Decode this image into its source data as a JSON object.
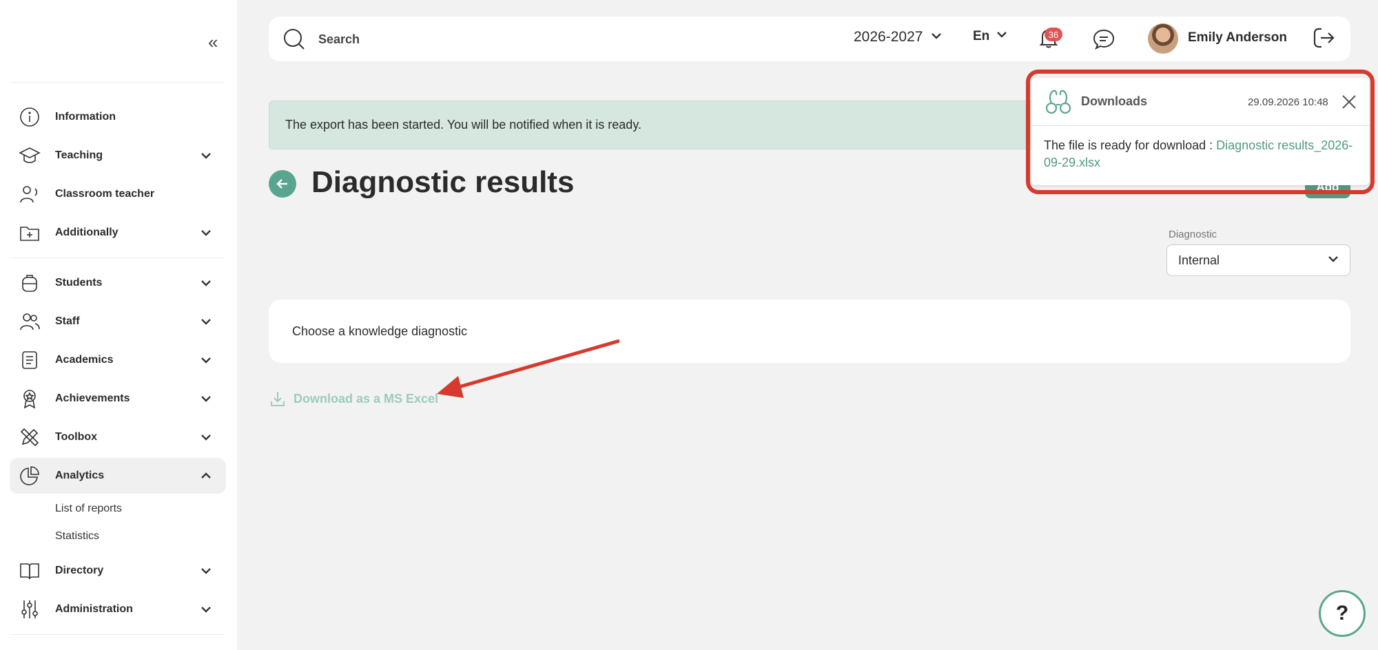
{
  "sidebar": {
    "items": [
      {
        "label": "Information",
        "icon": "info-icon"
      },
      {
        "label": "Teaching",
        "icon": "graduation-cap-icon"
      },
      {
        "label": "Classroom teacher",
        "icon": "teacher-icon"
      },
      {
        "label": "Additionally",
        "icon": "folder-plus-icon"
      },
      {
        "label": "Students",
        "icon": "backpack-icon"
      },
      {
        "label": "Staff",
        "icon": "users-icon"
      },
      {
        "label": "Academics",
        "icon": "document-icon"
      },
      {
        "label": "Achievements",
        "icon": "award-icon"
      },
      {
        "label": "Toolbox",
        "icon": "pencil-ruler-icon"
      },
      {
        "label": "Analytics",
        "icon": "pie-chart-icon"
      },
      {
        "label": "Directory",
        "icon": "book-icon"
      },
      {
        "label": "Administration",
        "icon": "sliders-icon"
      }
    ],
    "analytics_sub": [
      "List of reports",
      "Statistics"
    ]
  },
  "header": {
    "search_placeholder": "Search",
    "year": "2026-2027",
    "language": "En",
    "notifications_count": "36",
    "user_name": "Emily Anderson"
  },
  "alert": {
    "text": "The export has been started. You will be notified when it is ready."
  },
  "page": {
    "title": "Diagnostic results",
    "add_label": "Add"
  },
  "diagnostic": {
    "label": "Diagnostic",
    "value": "Internal"
  },
  "card": {
    "text": "Choose a knowledge diagnostic"
  },
  "download": {
    "label": "Download as a MS Excel"
  },
  "popup": {
    "title": "Downloads",
    "time": "29.09.2026 10:48",
    "message": "The file is ready for download : ",
    "file_link": "Diagnostic results_2026-09-29.xlsx"
  },
  "help": {
    "label": "?"
  },
  "colors": {
    "accent": "#5aa58f",
    "alert_bg": "#d5e7df",
    "annotation": "#d63a2e",
    "badge": "#e05454"
  }
}
